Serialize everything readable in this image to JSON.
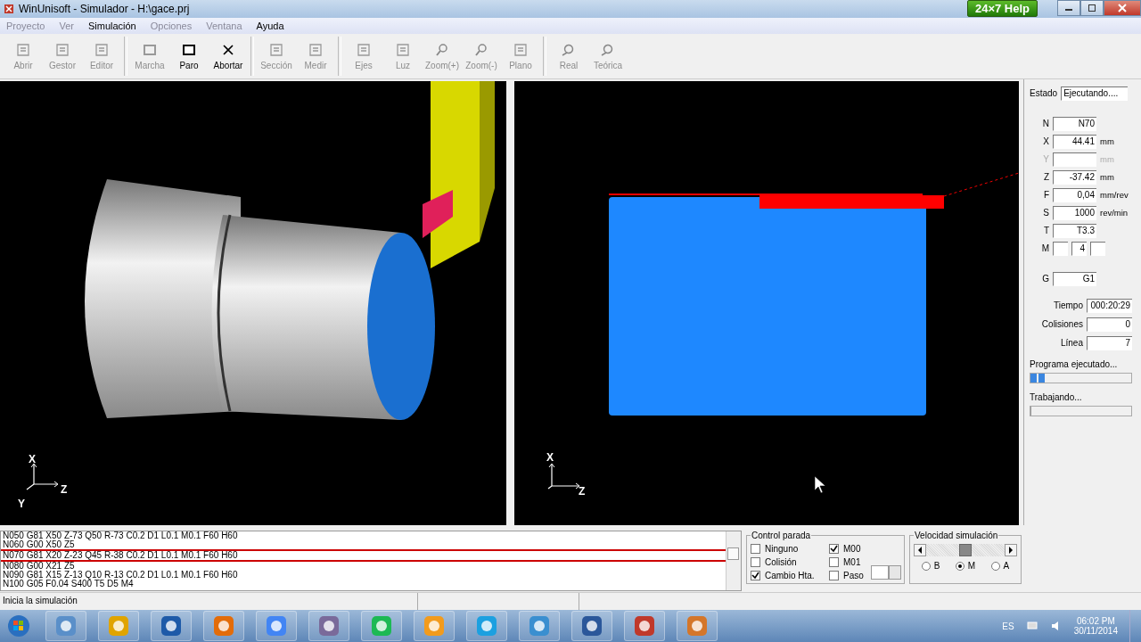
{
  "window": {
    "title": "WinUnisoft - Simulador - H:\\gace.prj",
    "help_button": "24×7 Help"
  },
  "menu": [
    {
      "label": "Proyecto",
      "disabled": true
    },
    {
      "label": "Ver",
      "disabled": true
    },
    {
      "label": "Simulación",
      "disabled": false
    },
    {
      "label": "Opciones",
      "disabled": true
    },
    {
      "label": "Ventana",
      "disabled": true
    },
    {
      "label": "Ayuda",
      "disabled": false
    }
  ],
  "toolbar": [
    [
      {
        "label": "Abrir",
        "disabled": true
      },
      {
        "label": "Gestor",
        "disabled": true
      },
      {
        "label": "Editor",
        "disabled": true
      }
    ],
    [
      {
        "label": "Marcha",
        "disabled": true
      },
      {
        "label": "Paro",
        "disabled": false
      },
      {
        "label": "Abortar",
        "disabled": false
      }
    ],
    [
      {
        "label": "Sección",
        "disabled": true
      },
      {
        "label": "Medir",
        "disabled": true
      }
    ],
    [
      {
        "label": "Ejes",
        "disabled": true
      },
      {
        "label": "Luz",
        "disabled": true
      },
      {
        "label": "Zoom(+)",
        "disabled": true
      },
      {
        "label": "Zoom(-)",
        "disabled": true
      },
      {
        "label": "Plano",
        "disabled": true
      }
    ],
    [
      {
        "label": "Real",
        "disabled": true
      },
      {
        "label": "Teórica",
        "disabled": true
      }
    ]
  ],
  "view_3d": {
    "axes": [
      "X",
      "Y",
      "Z"
    ]
  },
  "view_2d": {
    "axes": [
      "X",
      "Z"
    ]
  },
  "status_panel": {
    "state_label": "Estado",
    "state_value": "Ejecutando....",
    "readouts": [
      {
        "label": "N",
        "value": "N70",
        "kind": "field",
        "disabled": false
      },
      {
        "label": "X",
        "value": "44.41",
        "unit": "mm",
        "kind": "field",
        "disabled": false
      },
      {
        "label": "Y",
        "unit": "mm",
        "kind": "field",
        "disabled": true
      },
      {
        "label": "Z",
        "value": "-37.42",
        "unit": "mm",
        "kind": "field",
        "disabled": false
      },
      {
        "label": "F",
        "value": "0,04",
        "unit": "mm/rev",
        "kind": "field",
        "disabled": false
      },
      {
        "label": "S",
        "value": "1000",
        "unit": "rev/min",
        "kind": "field",
        "disabled": false
      },
      {
        "label": "T",
        "value": "T3.3",
        "kind": "field",
        "disabled": false
      },
      {
        "label": "M",
        "value": "4",
        "kind": "triple",
        "disabled": false
      },
      {
        "label": "G",
        "value": "G1",
        "kind": "field",
        "disabled": false
      }
    ],
    "counters": [
      {
        "label": "Tiempo",
        "value": "000:20:29"
      },
      {
        "label": "Colisiones",
        "value": "0"
      },
      {
        "label": "Línea",
        "value": "7"
      }
    ],
    "progress": [
      {
        "label": "Programa ejecutado...",
        "level": 0.14
      },
      {
        "label": "Trabajando...",
        "level": 0
      }
    ]
  },
  "program_lines": [
    {
      "text": "N050 G81 X50 Z-73 Q50 R-73 C0.2 D1 L0.1 M0.1 F60 H60",
      "selected": false
    },
    {
      "text": "N060 G00 X50 Z5",
      "selected": false
    },
    {
      "text": "N070 G81 X20 Z-23 Q45 R-38 C0.2 D1 L0.1 M0.1 F60 H60",
      "selected": true
    },
    {
      "text": "N080 G00 X21 Z5",
      "selected": false
    },
    {
      "text": "N090 G81 X15 Z-13 Q10 R-13 C0.2 D1 L0.1 M0.1 F60 H60",
      "selected": false
    },
    {
      "text": "N100 G05 F0.04 S400 T5 D5 M4",
      "selected": false
    }
  ],
  "stop_control": {
    "title": "Control parada",
    "options": [
      {
        "label": "Ninguno",
        "checked": false
      },
      {
        "label": "Colisión",
        "checked": false
      },
      {
        "label": "Cambio Hta.",
        "checked": true
      },
      {
        "label": "M00",
        "checked": true
      },
      {
        "label": "M01",
        "checked": false
      },
      {
        "label": "Paso",
        "checked": false
      }
    ]
  },
  "sim_speed": {
    "title": "Velocidad simulación",
    "level": 0.5,
    "options": [
      {
        "label": "B",
        "selected": false
      },
      {
        "label": "M",
        "selected": true
      },
      {
        "label": "A",
        "selected": false
      }
    ]
  },
  "status_bar": {
    "message": "Inicia la simulación"
  },
  "taskbar": {
    "language": "ES",
    "time": "06:02 PM",
    "date": "30/11/2014"
  }
}
